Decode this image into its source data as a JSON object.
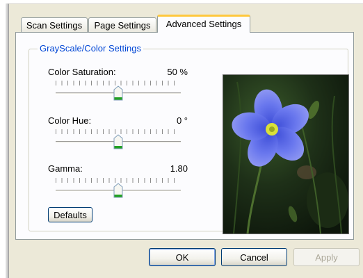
{
  "tabs": [
    {
      "label": "Scan Settings",
      "active": false
    },
    {
      "label": "Page Settings",
      "active": false
    },
    {
      "label": "Advanced Settings",
      "active": true
    }
  ],
  "group": {
    "title": "GrayScale/Color Settings",
    "sliders": [
      {
        "label": "Color Saturation:",
        "value": "50 %",
        "position": 0.5
      },
      {
        "label": "Color Hue:",
        "value": "0 °",
        "position": 0.5
      },
      {
        "label": "Gamma:",
        "value": "1.80",
        "position": 0.5
      }
    ],
    "defaults_label": "Defaults",
    "preview_icon": "flower-preview-image"
  },
  "buttons": {
    "ok": "OK",
    "cancel": "Cancel",
    "apply": "Apply"
  },
  "colors": {
    "accent_tab": "#ffc83c",
    "group_title": "#0046d5",
    "button_border": "#003c74",
    "thumb_green": "#21a121"
  }
}
